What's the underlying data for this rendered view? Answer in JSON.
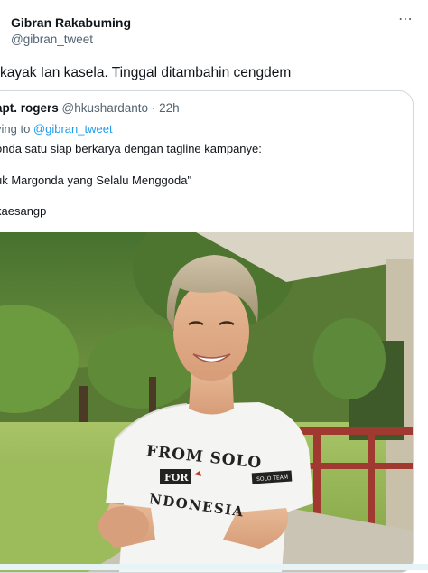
{
  "author": {
    "name": "Gibran Rakabuming",
    "handle": "@gibran_tweet"
  },
  "tweet": {
    "text": "kayak Ian kasela. Tinggal ditambahin cengdem"
  },
  "icons": {
    "more": "more-horizontal-icon"
  },
  "quote": {
    "name": "apt. rogers",
    "handle": "@hkushardanto",
    "dot": "·",
    "time": "22h",
    "reply_prefix": "ying to",
    "reply_handle": "@gibran_tweet",
    "line1": "onda satu siap berkarya dengan tagline kampanye:",
    "line2": "uk Margonda yang Selalu Menggoda\"",
    "line3": "kaesangp"
  },
  "photo": {
    "shirt_line1": "FROM SOLO",
    "shirt_line2": "FOR",
    "shirt_line3": "NDONESIA",
    "sleeve_tag": "SOLO TEAM"
  },
  "colors": {
    "text": "#0f1419",
    "secondary": "#536471",
    "link": "#1d9bf0",
    "border": "#cfd9de"
  }
}
